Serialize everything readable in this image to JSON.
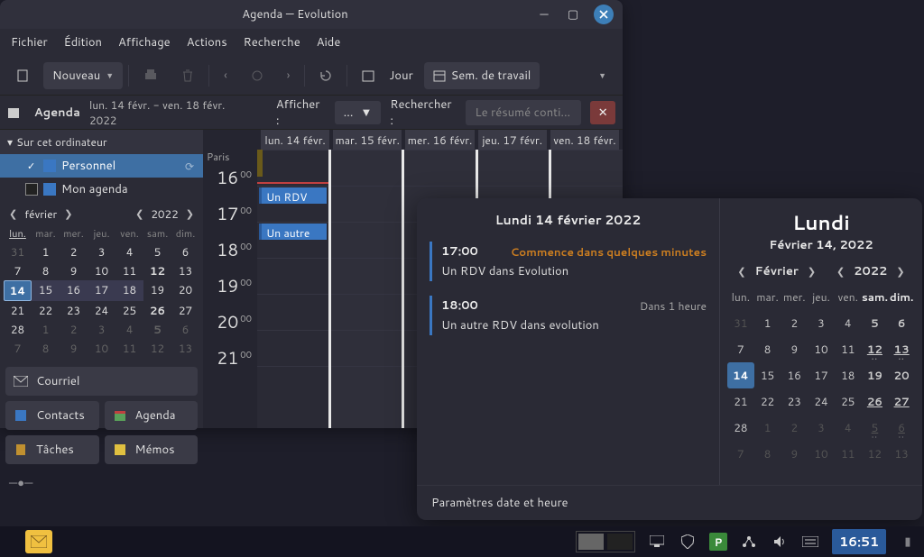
{
  "window": {
    "title": "Agenda — Evolution"
  },
  "menu": {
    "file": "Fichier",
    "edit": "Édition",
    "view": "Affichage",
    "actions": "Actions",
    "search": "Recherche",
    "help": "Aide"
  },
  "toolbar": {
    "new_label": "Nouveau",
    "view_mode": "Jour",
    "view_range": "Sem. de travail"
  },
  "filterbar": {
    "title": "Agenda",
    "daterange": "lun. 14 févr. - ven. 18 févr. 2022",
    "afficher": "Afficher :",
    "afficher_value": "…",
    "rechercher": "Rechercher :",
    "search_placeholder": "Le résumé conti…"
  },
  "sidebar": {
    "section": "Sur cet ordinateur",
    "calendars": [
      {
        "name": "Personnel",
        "color": "#3a77c2",
        "checked": true
      },
      {
        "name": "Mon agenda",
        "color": "#3a77c2",
        "checked": false
      }
    ]
  },
  "mini_cal": {
    "month": "février",
    "year": "2022",
    "dow": [
      "lun.",
      "mar.",
      "mer.",
      "jeu.",
      "ven.",
      "sam.",
      "dim."
    ],
    "weeks": [
      [
        {
          "d": "31",
          "o": true
        },
        {
          "d": "1"
        },
        {
          "d": "2"
        },
        {
          "d": "3"
        },
        {
          "d": "4"
        },
        {
          "d": "5"
        },
        {
          "d": "6"
        }
      ],
      [
        {
          "d": "7"
        },
        {
          "d": "8"
        },
        {
          "d": "9"
        },
        {
          "d": "10"
        },
        {
          "d": "11"
        },
        {
          "d": "12",
          "b": true
        },
        {
          "d": "13"
        }
      ],
      [
        {
          "d": "14",
          "today": true
        },
        {
          "d": "15",
          "sel": true
        },
        {
          "d": "16",
          "sel": true
        },
        {
          "d": "17",
          "sel": true
        },
        {
          "d": "18",
          "sel": true
        },
        {
          "d": "19"
        },
        {
          "d": "20"
        }
      ],
      [
        {
          "d": "21"
        },
        {
          "d": "22"
        },
        {
          "d": "23"
        },
        {
          "d": "24"
        },
        {
          "d": "25"
        },
        {
          "d": "26",
          "b": true
        },
        {
          "d": "27"
        }
      ],
      [
        {
          "d": "28"
        },
        {
          "d": "1",
          "o": true
        },
        {
          "d": "2",
          "o": true
        },
        {
          "d": "3",
          "o": true
        },
        {
          "d": "4",
          "o": true
        },
        {
          "d": "5",
          "o": true,
          "b": true
        },
        {
          "d": "6",
          "o": true
        }
      ],
      [
        {
          "d": "7",
          "o": true
        },
        {
          "d": "8",
          "o": true
        },
        {
          "d": "9",
          "o": true
        },
        {
          "d": "10",
          "o": true
        },
        {
          "d": "11",
          "o": true
        },
        {
          "d": "12",
          "o": true
        },
        {
          "d": "13",
          "o": true
        }
      ]
    ]
  },
  "nav": {
    "mail": "Courriel",
    "contacts": "Contacts",
    "agenda": "Agenda",
    "tasks": "Tâches",
    "memos": "Mémos"
  },
  "day_headers": [
    "lun. 14 févr.",
    "mar. 15 févr.",
    "mer. 16 févr.",
    "jeu. 17 févr.",
    "ven. 18 févr."
  ],
  "hours": [
    "16",
    "17",
    "18",
    "19",
    "20",
    "21"
  ],
  "minute": "00",
  "timezone": "Paris",
  "events": [
    {
      "label": "Un RDV",
      "hour_index": 1
    },
    {
      "label": "Un autre",
      "hour_index": 2
    }
  ],
  "popup": {
    "left_title": "Lundi 14 février 2022",
    "events": [
      {
        "time": "17:00",
        "status": "Commence dans quelques minutes",
        "hot": true,
        "desc": "Un RDV dans Evolution"
      },
      {
        "time": "18:00",
        "status": "Dans 1 heure",
        "hot": false,
        "desc": "Un autre RDV dans evolution"
      }
    ],
    "footer": "Paramètres date et heure",
    "right": {
      "day": "Lundi",
      "subtitle": "Février 14, 2022",
      "month": "Février",
      "year": "2022",
      "dow": [
        "lun.",
        "mar.",
        "mer.",
        "jeu.",
        "ven.",
        "sam.",
        "dim."
      ],
      "weeks": [
        [
          {
            "d": "31",
            "o": true
          },
          {
            "d": "1"
          },
          {
            "d": "2"
          },
          {
            "d": "3"
          },
          {
            "d": "4"
          },
          {
            "d": "5",
            "b": true
          },
          {
            "d": "6",
            "b": true
          }
        ],
        [
          {
            "d": "7"
          },
          {
            "d": "8"
          },
          {
            "d": "9"
          },
          {
            "d": "10"
          },
          {
            "d": "11"
          },
          {
            "d": "12",
            "b": true,
            "dots": true,
            "u": true
          },
          {
            "d": "13",
            "b": true,
            "dots": true,
            "u": true
          }
        ],
        [
          {
            "d": "14",
            "today": true
          },
          {
            "d": "15"
          },
          {
            "d": "16"
          },
          {
            "d": "17"
          },
          {
            "d": "18"
          },
          {
            "d": "19",
            "b": true
          },
          {
            "d": "20",
            "b": true
          }
        ],
        [
          {
            "d": "21"
          },
          {
            "d": "22"
          },
          {
            "d": "23"
          },
          {
            "d": "24"
          },
          {
            "d": "25"
          },
          {
            "d": "26",
            "b": true,
            "u": true
          },
          {
            "d": "27",
            "b": true,
            "u": true
          }
        ],
        [
          {
            "d": "28"
          },
          {
            "d": "1",
            "o": true
          },
          {
            "d": "2",
            "o": true
          },
          {
            "d": "3",
            "o": true
          },
          {
            "d": "4",
            "o": true
          },
          {
            "d": "5",
            "o": true,
            "dots": true,
            "u": true
          },
          {
            "d": "6",
            "o": true,
            "dots": true,
            "u": true
          }
        ],
        [
          {
            "d": "7",
            "o": true
          },
          {
            "d": "8",
            "o": true
          },
          {
            "d": "9",
            "o": true
          },
          {
            "d": "10",
            "o": true
          },
          {
            "d": "11",
            "o": true
          },
          {
            "d": "12",
            "o": true
          },
          {
            "d": "13",
            "o": true
          }
        ]
      ]
    }
  },
  "taskbar": {
    "clock": "16:51"
  }
}
